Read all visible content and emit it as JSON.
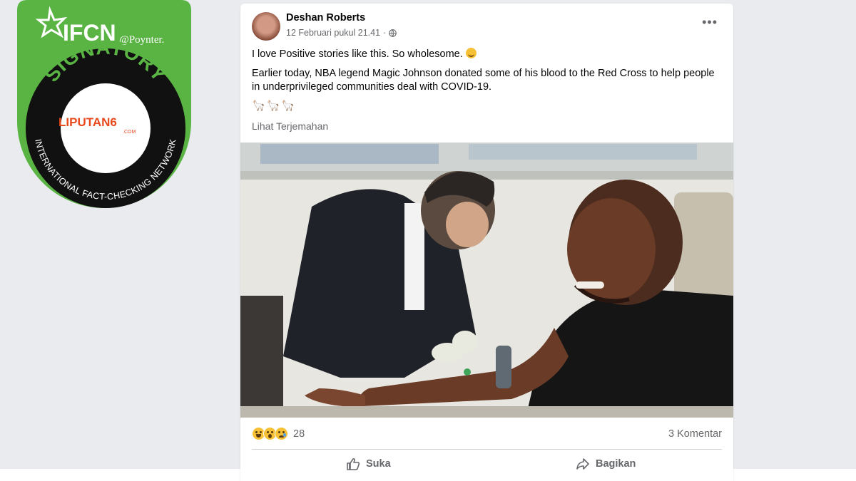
{
  "badge": {
    "ifcn": "IFCN",
    "poynter": "@Poynter.",
    "signatory": "SIGNATORY",
    "network": "INTERNATIONAL FACT-CHECKING NETWORK",
    "member_logo": "LIPUTAN6",
    "member_logo_sub": ".COM",
    "colors": {
      "green": "#59b443",
      "black": "#111111",
      "red": "#e8481c"
    }
  },
  "post": {
    "author": "Deshan Roberts",
    "timestamp": "12 Februari pukul 21.41",
    "privacy_icon": "globe-icon",
    "more_icon": "more-options-icon",
    "text_line1": "I love Positive stories like this. So wholesome.",
    "text_body": "Earlier today, NBA legend Magic Johnson donated some of his blood to the Red Cross to help people in underprivileged communities deal with COVID-19.",
    "emoji_row": "🦙🦙🦙",
    "translate_link": "Lihat Terjemahan",
    "reaction_count": "28",
    "comments": "3 Komentar",
    "actions": {
      "like": "Suka",
      "share": "Bagikan"
    }
  }
}
